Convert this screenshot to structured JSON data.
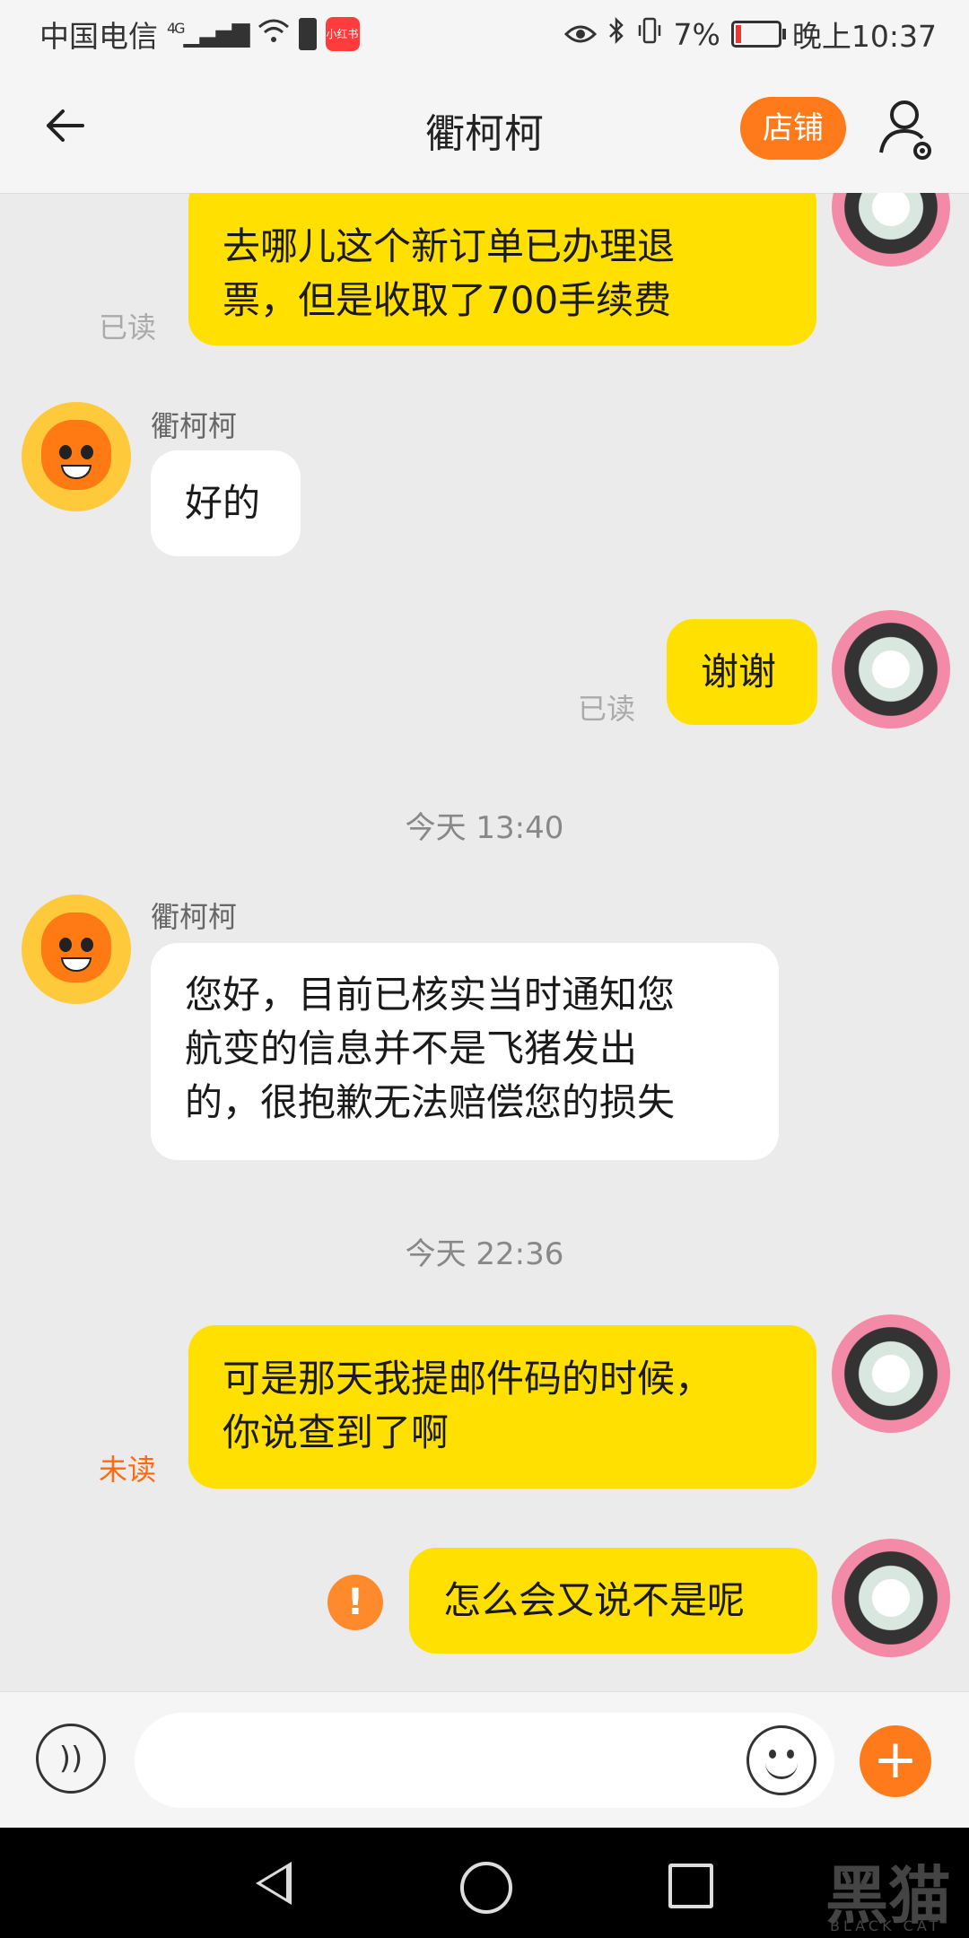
{
  "status_bar": {
    "carrier": "中国电信",
    "network": "4G",
    "battery_percent": "7%",
    "time": "晚上10:37"
  },
  "header": {
    "title": "衢柯柯",
    "shop_label": "店铺",
    "back_icon": "arrow-left-icon",
    "user_settings_icon": "user-settings-icon"
  },
  "messages": [
    {
      "side": "me",
      "text_lines": [
        "去哪儿这个新订单已办理退",
        "票，但是收取了700手续费"
      ],
      "status": "已读"
    },
    {
      "side": "them",
      "sender": "衢柯柯",
      "text_lines": [
        "好的"
      ]
    },
    {
      "side": "me",
      "text_lines": [
        "谢谢"
      ],
      "status": "已读"
    },
    {
      "type": "time",
      "text": "今天  13:40"
    },
    {
      "side": "them",
      "sender": "衢柯柯",
      "text_lines": [
        "您好，目前已核实当时通知您",
        "航变的信息并不是飞猪发出",
        "的，很抱歉无法赔偿您的损失"
      ]
    },
    {
      "type": "time",
      "text": "今天  22:36"
    },
    {
      "side": "me",
      "text_lines": [
        "可是那天我提邮件码的时候，",
        "你说查到了啊"
      ],
      "status": "未读"
    },
    {
      "side": "me",
      "text_lines": [
        "怎么会又说不是呢"
      ],
      "status_icon": "exclamation-icon",
      "failed_mark": "!"
    }
  ],
  "input_bar": {
    "voice_icon": "voice-icon",
    "emoji_icon": "emoji-icon",
    "plus_icon": "plus-icon"
  },
  "watermark": {
    "text": "黑猫",
    "sub": "BLACK CAT"
  },
  "colors": {
    "accent": "#ff7a1a",
    "my_bubble": "#ffe000",
    "their_bubble": "#ffffff",
    "unread": "#ff6a10"
  }
}
